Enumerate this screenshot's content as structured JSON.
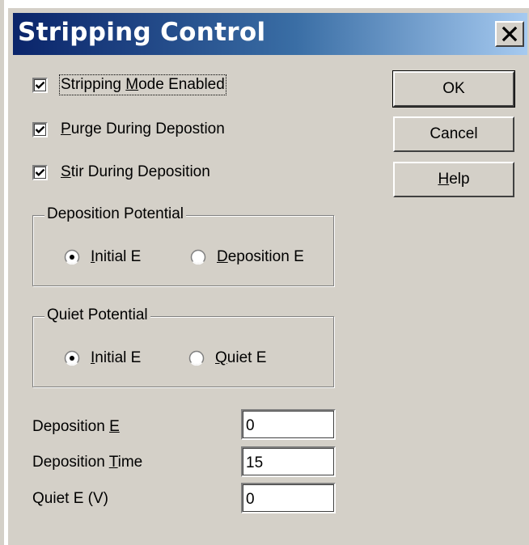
{
  "window": {
    "title": "Stripping Control",
    "close_label": "X"
  },
  "checkboxes": [
    {
      "pre": "Stripping ",
      "ul": "M",
      "post": "ode Enabled",
      "checked": true
    },
    {
      "pre": "",
      "ul": "P",
      "post": "urge During Depostion",
      "checked": true
    },
    {
      "pre": "",
      "ul": "S",
      "post": "tir During Deposition",
      "checked": true
    }
  ],
  "deposition_potential": {
    "title": "Deposition Potential",
    "options": [
      {
        "pre": "",
        "ul": "I",
        "post": "nitial E",
        "selected": true
      },
      {
        "pre": "",
        "ul": "D",
        "post": "eposition E",
        "selected": false
      }
    ]
  },
  "quiet_potential": {
    "title": "Quiet Potential",
    "options": [
      {
        "pre": "",
        "ul": "I",
        "post": "nitial E",
        "selected": true
      },
      {
        "pre": "",
        "ul": "Q",
        "post": "uiet E",
        "selected": false
      }
    ]
  },
  "fields": [
    {
      "pre": "Deposition ",
      "ul": "E",
      "post": "",
      "value": "0"
    },
    {
      "pre": "Deposition ",
      "ul": "T",
      "post": "ime",
      "value": "15"
    },
    {
      "pre": "Quiet E (V)",
      "ul": "",
      "post": "",
      "value": "0"
    }
  ],
  "buttons": {
    "ok": "OK",
    "cancel": "Cancel",
    "help_ul": "H",
    "help_rest": "elp"
  },
  "colors": {
    "dialog_bg": "#d4d0c8",
    "title_start": "#0a246a",
    "title_end": "#a6caf0"
  }
}
